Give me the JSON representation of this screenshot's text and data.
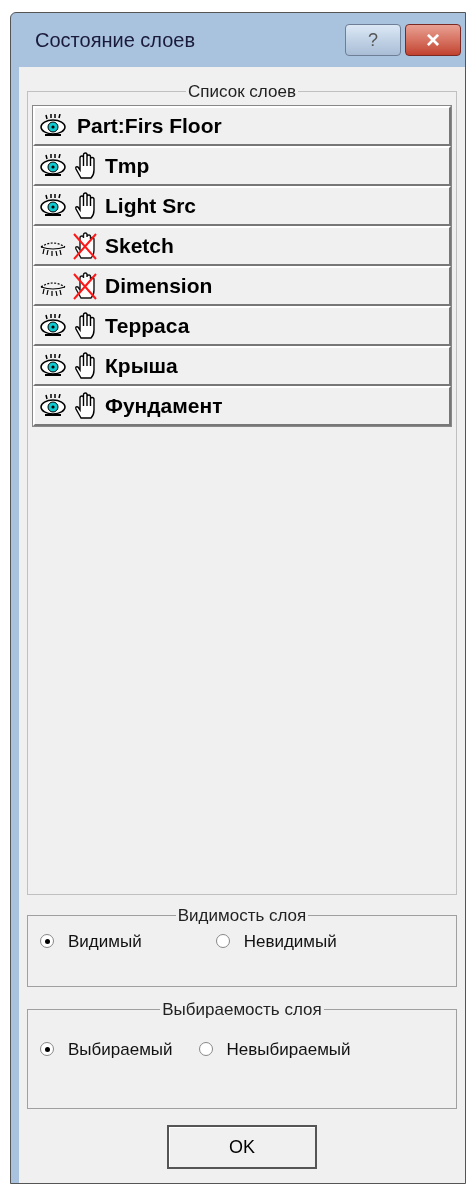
{
  "window": {
    "title": "Состояние слоев",
    "help_button": "?",
    "close_button": "×"
  },
  "layer_list": {
    "title": "Список слоев",
    "layers": [
      {
        "name": "Part:Firs Floor",
        "kind": "current",
        "visible": true,
        "selected": false
      },
      {
        "name": "Tmp",
        "kind": "layer",
        "visible": true,
        "selectable": true,
        "selected": false
      },
      {
        "name": "Light Src",
        "kind": "layer",
        "visible": true,
        "selectable": true,
        "selected": false
      },
      {
        "name": "Sketch",
        "kind": "layer",
        "visible": false,
        "selectable": false,
        "selected": false
      },
      {
        "name": "Dimension",
        "kind": "layer",
        "visible": false,
        "selectable": false,
        "selected": false
      },
      {
        "name": "Терраса",
        "kind": "layer",
        "visible": true,
        "selectable": true,
        "selected": false
      },
      {
        "name": "Крыша",
        "kind": "layer",
        "visible": true,
        "selectable": true,
        "selected": false
      },
      {
        "name": "Фундамент",
        "kind": "layer",
        "visible": true,
        "selectable": true,
        "selected": false
      }
    ]
  },
  "groups": [
    {
      "title": "Видимость слоя",
      "options": [
        {
          "label": "Видимый",
          "selected": true
        },
        {
          "label": "Невидимый",
          "selected": false
        }
      ]
    },
    {
      "title": "Выбираемость слоя",
      "options": [
        {
          "label": "Выбираемый",
          "selected": true
        },
        {
          "label": "Невыбираемый",
          "selected": false
        }
      ]
    }
  ],
  "ok_button": "OK"
}
